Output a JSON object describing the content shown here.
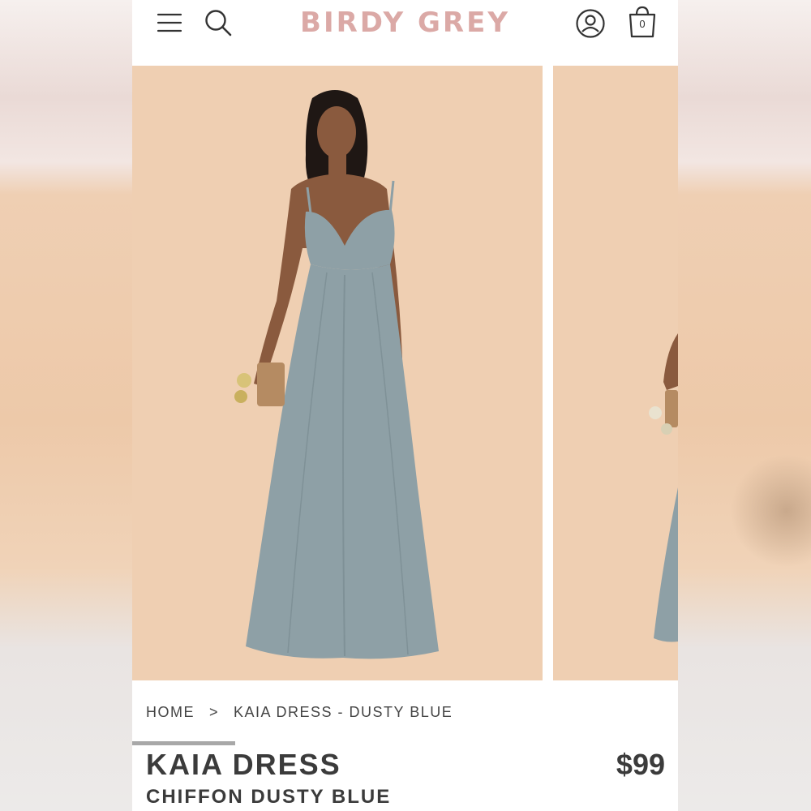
{
  "brand": {
    "logo_text": "BIRDY GREY",
    "logo_color": "#dba9a6"
  },
  "header": {
    "icons": [
      "menu-icon",
      "search-icon",
      "account-icon",
      "shopping-bag-icon"
    ],
    "cart_count": "0"
  },
  "carousel": {
    "slide_background": "#efcfb2",
    "dress_color": "#8ea0a6",
    "progress": 0.25
  },
  "breadcrumb": {
    "home": "HOME",
    "separator": ">",
    "current": "KAIA DRESS - DUSTY BLUE"
  },
  "product": {
    "title": "KAIA DRESS",
    "subtitle": "CHIFFON DUSTY BLUE",
    "price": "$99"
  }
}
